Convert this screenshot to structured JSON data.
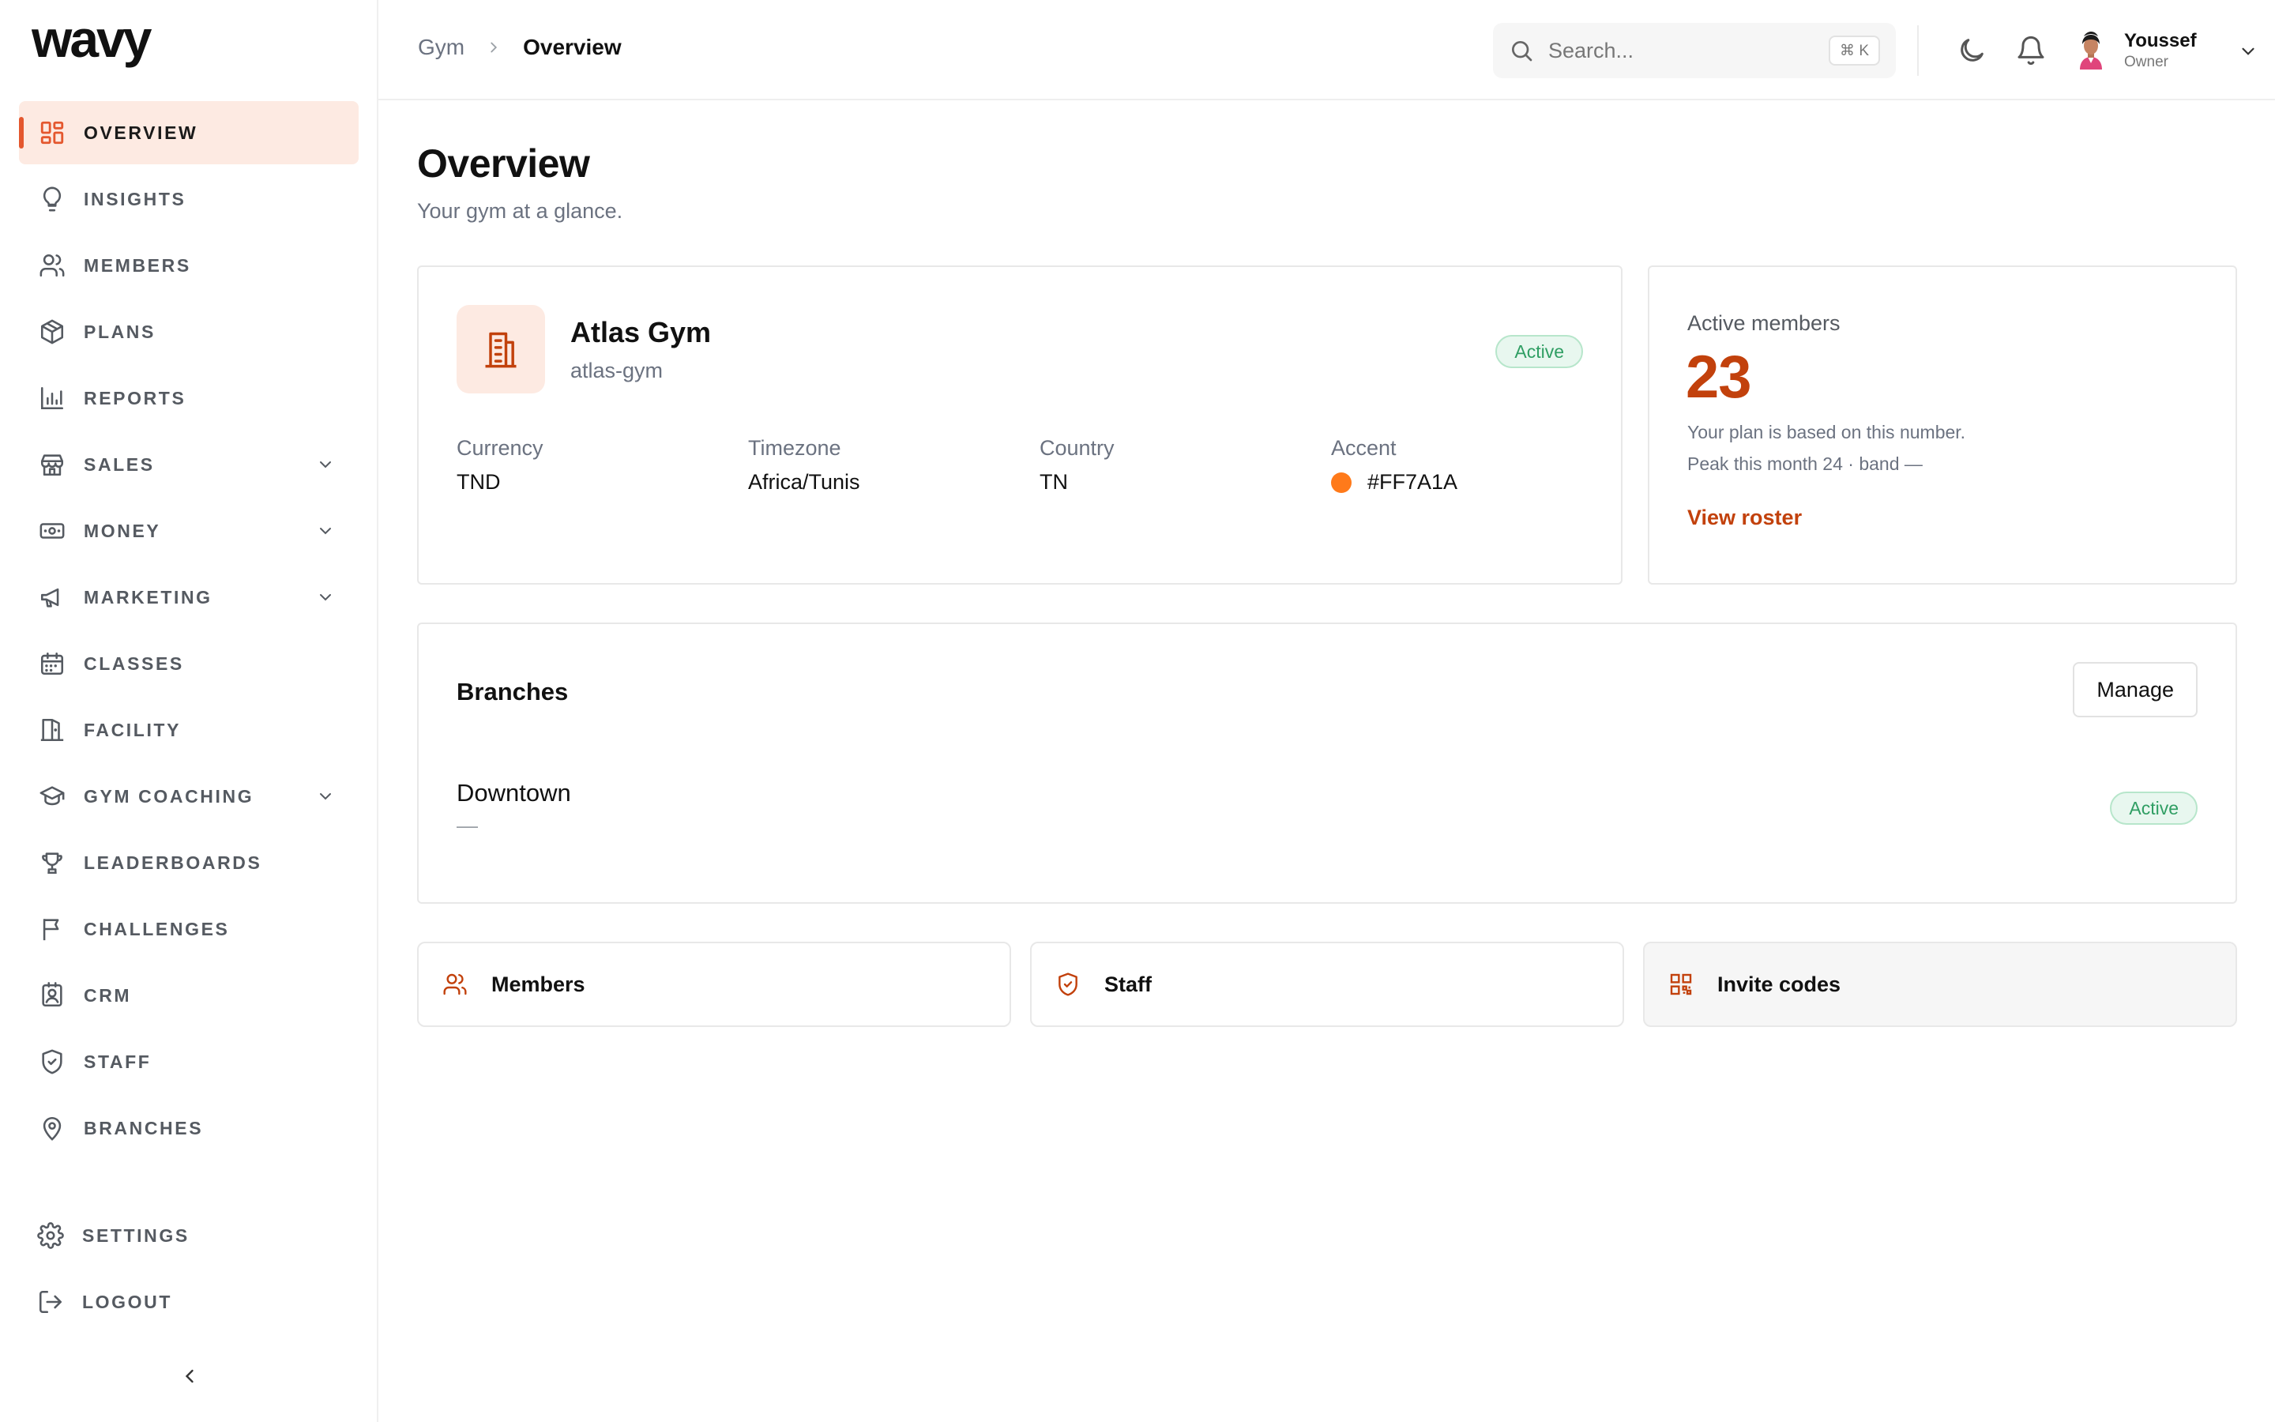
{
  "app": {
    "brand": "wavy",
    "accent_color": "#E4572E"
  },
  "sidebar": {
    "items": [
      {
        "label": "OVERVIEW",
        "icon": "dashboard-grid-icon",
        "active": true
      },
      {
        "label": "INSIGHTS",
        "icon": "lightbulb-icon"
      },
      {
        "label": "MEMBERS",
        "icon": "users-icon"
      },
      {
        "label": "PLANS",
        "icon": "package-icon"
      },
      {
        "label": "REPORTS",
        "icon": "bar-chart-icon"
      },
      {
        "label": "SALES",
        "icon": "store-icon",
        "expandable": true
      },
      {
        "label": "MONEY",
        "icon": "banknote-icon",
        "expandable": true
      },
      {
        "label": "MARKETING",
        "icon": "megaphone-icon",
        "expandable": true
      },
      {
        "label": "CLASSES",
        "icon": "calendar-icon"
      },
      {
        "label": "FACILITY",
        "icon": "door-icon"
      },
      {
        "label": "GYM COACHING",
        "icon": "graduation-cap-icon",
        "expandable": true
      },
      {
        "label": "LEADERBOARDS",
        "icon": "trophy-icon"
      },
      {
        "label": "CHALLENGES",
        "icon": "flag-icon"
      },
      {
        "label": "CRM",
        "icon": "contact-icon"
      },
      {
        "label": "STAFF",
        "icon": "shield-check-icon"
      },
      {
        "label": "BRANCHES",
        "icon": "map-pin-icon"
      }
    ],
    "bottom": [
      {
        "label": "SETTINGS",
        "icon": "gear-icon"
      },
      {
        "label": "LOGOUT",
        "icon": "logout-icon"
      }
    ]
  },
  "header": {
    "breadcrumb": {
      "parent": "Gym",
      "current": "Overview"
    },
    "search": {
      "placeholder": "Search...",
      "shortcut": "⌘ K"
    },
    "user": {
      "name": "Youssef",
      "role": "Owner"
    }
  },
  "main": {
    "title": "Overview",
    "subtitle": "Your gym at a glance.",
    "gym": {
      "name": "Atlas Gym",
      "slug": "atlas-gym",
      "status": "Active",
      "fields": [
        {
          "label": "Currency",
          "value": "TND"
        },
        {
          "label": "Timezone",
          "value": "Africa/Tunis"
        },
        {
          "label": "Country",
          "value": "TN"
        },
        {
          "label": "Accent",
          "value": "#FF7A1A"
        }
      ],
      "accent_color": "#FF7A1A"
    },
    "active_members": {
      "label": "Active members",
      "count": "23",
      "note": "Your plan is based on this number.",
      "peak": "Peak this month 24 · band —",
      "link": "View roster"
    },
    "branches": {
      "title": "Branches",
      "manage_label": "Manage",
      "items": [
        {
          "name": "Downtown",
          "sub": "—",
          "status": "Active"
        }
      ]
    },
    "quick_links": [
      {
        "label": "Members",
        "icon": "users-icon"
      },
      {
        "label": "Staff",
        "icon": "shield-check-icon"
      },
      {
        "label": "Invite codes",
        "icon": "qr-code-icon"
      }
    ]
  }
}
